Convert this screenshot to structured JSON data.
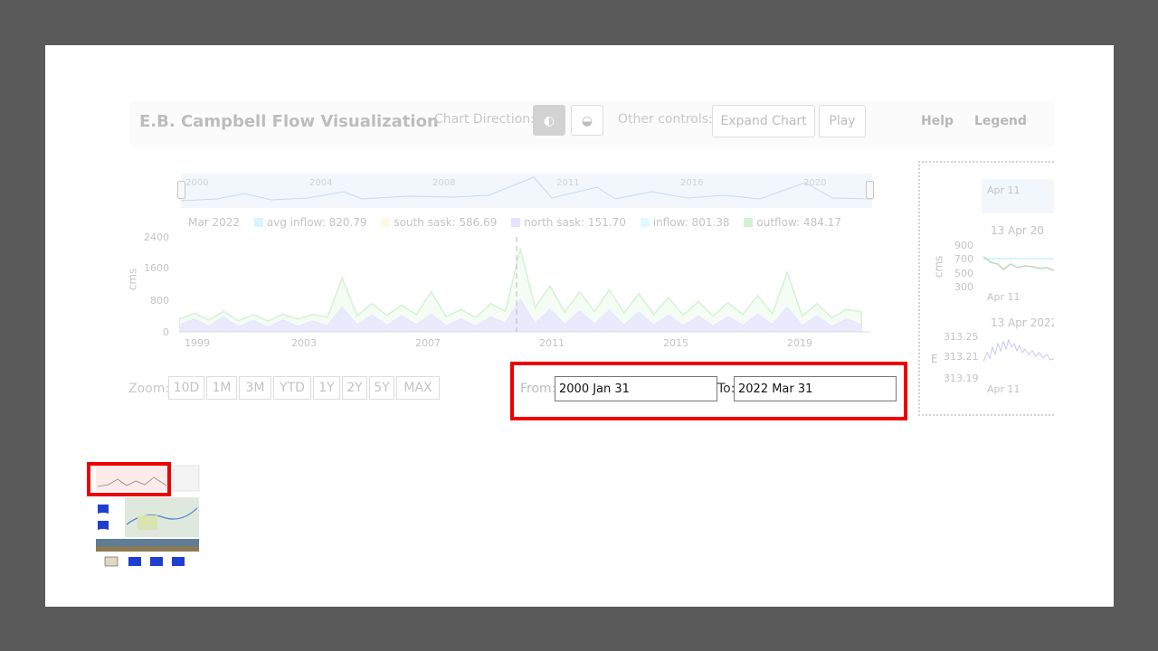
{
  "header": {
    "title": "E.B. Campbell Flow Visualization",
    "chart_direction_label": "Chart Direction:",
    "direction_buttons": [
      "◐",
      "◒"
    ],
    "other_controls_label": "Other controls:",
    "expand_chart_label": "Expand Chart",
    "play_label": "Play",
    "help_label": "Help",
    "legend_label": "Legend"
  },
  "navigator": {
    "years": [
      "2000",
      "2004",
      "2008",
      "2011",
      "2016",
      "2020"
    ]
  },
  "legend": {
    "date": "Mar 2022",
    "items": [
      {
        "label": "avg inflow: 820.79",
        "color": "#7fe3ff"
      },
      {
        "label": "south sask: 586.69",
        "color": "#fbf2a8"
      },
      {
        "label": "north sask: 151.70",
        "color": "#aaaaff"
      },
      {
        "label": "inflow: 801.38",
        "color": "#9ff0ff"
      },
      {
        "label": "outflow: 484.17",
        "color": "#78d878"
      }
    ]
  },
  "chart_data": {
    "type": "area",
    "ylabel": "cms",
    "ylim": [
      0,
      2400
    ],
    "yticks": [
      "2400",
      "1600",
      "800",
      "0"
    ],
    "xticks": [
      "1999",
      "2003",
      "2007",
      "2011",
      "2015",
      "2019"
    ],
    "series": [
      {
        "name": "north sask",
        "color": "#b4b4ff",
        "x": [
          1999,
          1999.5,
          2000,
          2000.5,
          2001,
          2001.5,
          2002,
          2002.5,
          2003,
          2003.5,
          2004,
          2004.5,
          2005,
          2005.5,
          2006,
          2006.5,
          2007,
          2007.5,
          2008,
          2008.5,
          2009,
          2009.5,
          2010,
          2010.5,
          2011,
          2011.5,
          2012,
          2012.5,
          2013,
          2013.5,
          2014,
          2014.5,
          2015,
          2015.5,
          2016,
          2016.5,
          2017,
          2017.5,
          2018,
          2018.5,
          2019,
          2019.5,
          2020,
          2020.5,
          2021,
          2021.5,
          2022
        ],
        "y": [
          150,
          300,
          120,
          350,
          100,
          260,
          90,
          280,
          110,
          250,
          130,
          600,
          150,
          400,
          140,
          380,
          160,
          420,
          130,
          300,
          120,
          350,
          200,
          800,
          180,
          550,
          160,
          500,
          170,
          520,
          150,
          480,
          140,
          400,
          130,
          380,
          120,
          360,
          140,
          420,
          160,
          600,
          130,
          380,
          110,
          300,
          150
        ]
      },
      {
        "name": "outflow",
        "color": "#78d878",
        "x": [
          1999,
          1999.5,
          2000,
          2000.5,
          2001,
          2001.5,
          2002,
          2002.5,
          2003,
          2003.5,
          2004,
          2004.5,
          2005,
          2005.5,
          2006,
          2006.5,
          2007,
          2007.5,
          2008,
          2008.5,
          2009,
          2009.5,
          2010,
          2010.5,
          2011,
          2011.5,
          2012,
          2012.5,
          2013,
          2013.5,
          2014,
          2014.5,
          2015,
          2015.5,
          2016,
          2016.5,
          2017,
          2017.5,
          2018,
          2018.5,
          2019,
          2019.5,
          2020,
          2020.5,
          2021,
          2021.5,
          2022
        ],
        "y": [
          300,
          450,
          280,
          500,
          260,
          420,
          250,
          430,
          300,
          420,
          350,
          1350,
          380,
          700,
          400,
          650,
          420,
          1000,
          360,
          550,
          340,
          700,
          500,
          2100,
          600,
          1150,
          480,
          1000,
          500,
          1050,
          460,
          950,
          420,
          850,
          400,
          750,
          380,
          720,
          420,
          900,
          440,
          1500,
          380,
          700,
          330,
          550,
          484
        ]
      }
    ]
  },
  "zoom": {
    "label": "Zoom:",
    "buttons": [
      "10D",
      "1M",
      "3M",
      "YTD",
      "1Y",
      "2Y",
      "5Y",
      "MAX"
    ]
  },
  "date_range": {
    "from_label": "From:",
    "from_value": "2000 Jan 31",
    "to_label": "To:",
    "to_value": "2022 Mar 31"
  },
  "side_panel": {
    "nav_label": "Apr 11",
    "chart1_title": "13 Apr 20",
    "chart1_yticks": [
      "900",
      "700",
      "500",
      "300"
    ],
    "chart1_ylabel": "cms",
    "chart1_xlabel": "Apr 11",
    "chart2_title": "13 Apr 2022",
    "chart2_yticks": [
      "313.25",
      "313.21",
      "313.19"
    ],
    "chart2_ylabel": "E",
    "chart2_xlabel": "Apr 11"
  }
}
